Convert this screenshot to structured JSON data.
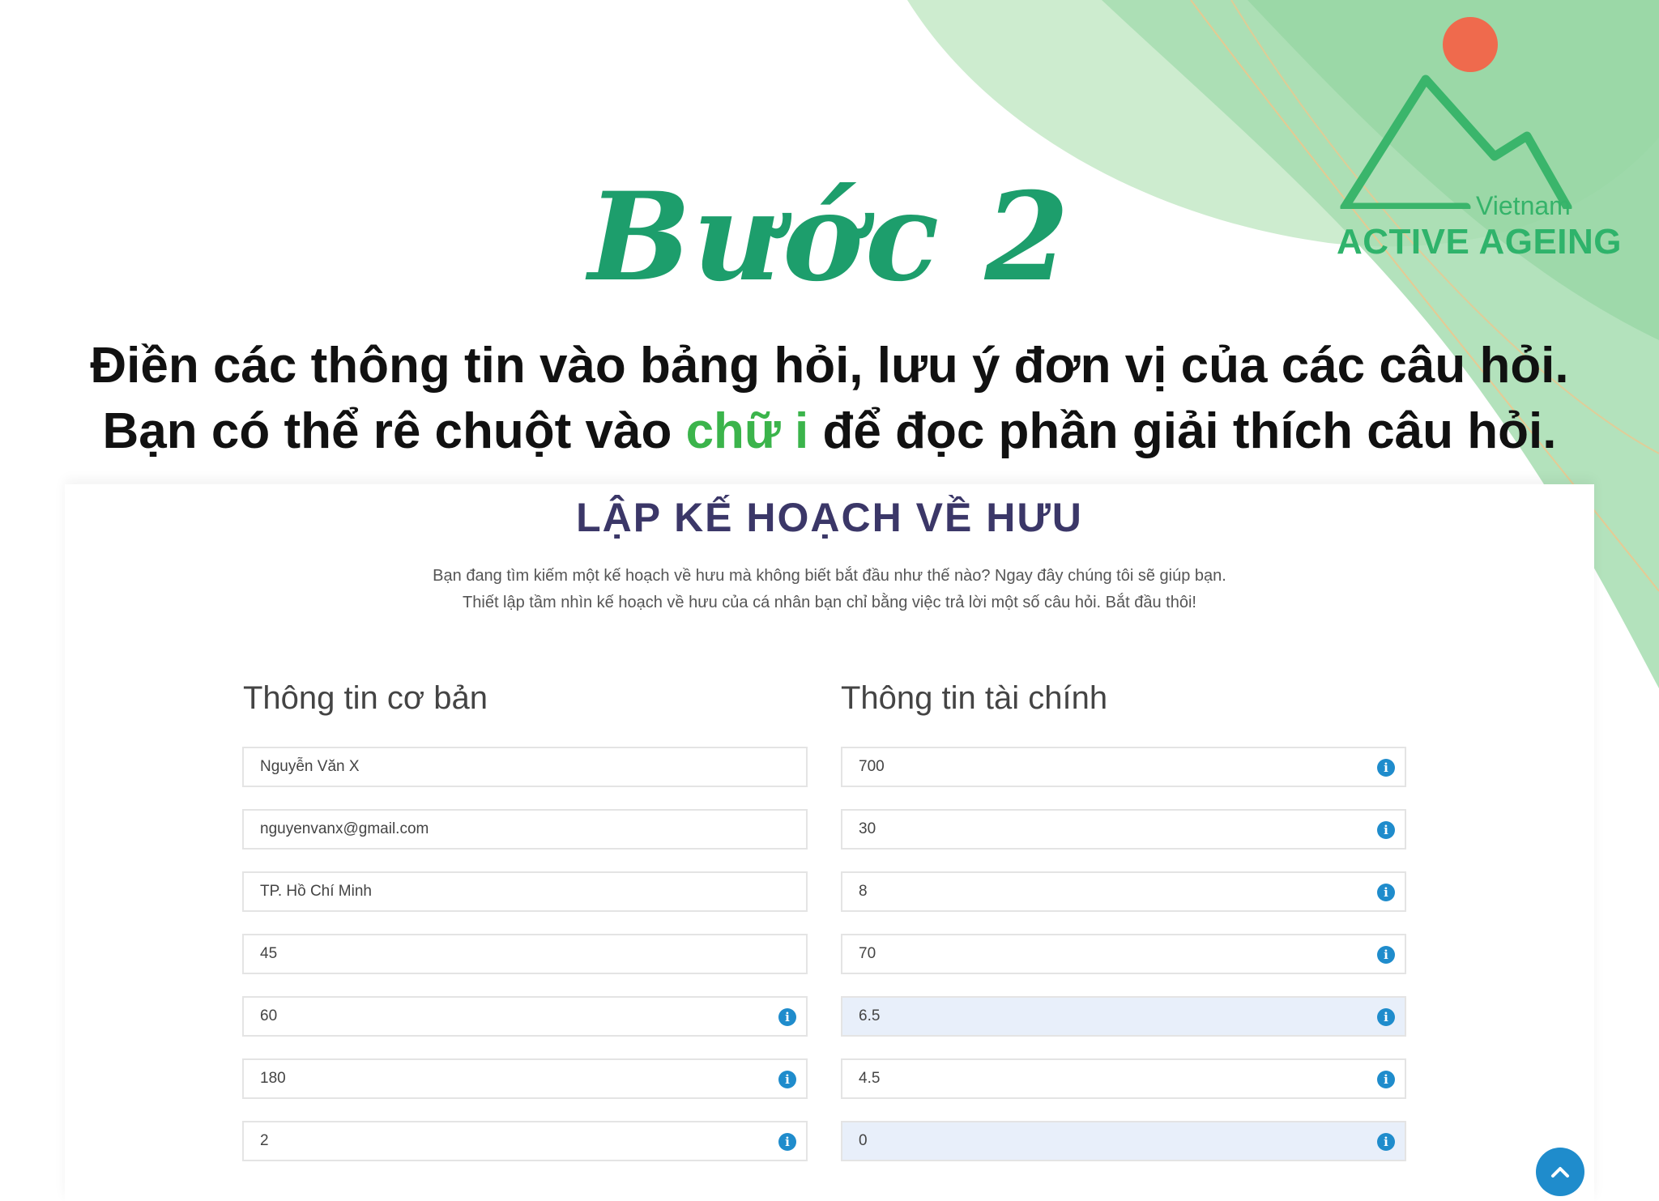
{
  "logo": {
    "vietnam": "Vietnam",
    "active_ageing": "ACTIVE AGEING",
    "sun_color": "#ef6a4d",
    "mountain_color": "#3ab56b"
  },
  "step": {
    "title": "Bước 2"
  },
  "instructions": {
    "line1": "Điền các thông tin vào bảng hỏi, lưu ý đơn vị của các câu hỏi.",
    "line2_before": "Bạn có thể rê chuột vào ",
    "line2_highlight": "chữ i",
    "line2_after": " để đọc phần giải thích câu hỏi."
  },
  "form": {
    "title": "LẬP KẾ HOẠCH VỀ HƯU",
    "intro_line1": "Bạn đang tìm kiếm một kế hoạch về hưu mà không biết bắt đầu như thế nào? Ngay đây chúng tôi sẽ giúp bạn.",
    "intro_line2": "Thiết lập tầm nhìn kế hoạch về hưu của cá nhân bạn chỉ bằng việc trả lời một số câu hỏi. Bắt đầu thôi!",
    "left_title": "Thông tin cơ bản",
    "right_title": "Thông tin tài chính",
    "left_fields": [
      {
        "value": "Nguyễn Văn X"
      },
      {
        "value": "nguyenvanx@gmail.com"
      },
      {
        "value": "TP. Hồ Chí Minh"
      },
      {
        "value": "45"
      },
      {
        "value": "60",
        "info": "i"
      },
      {
        "value": "180",
        "info": "i"
      },
      {
        "value": "2",
        "info": "i"
      }
    ],
    "right_fields": [
      {
        "value": "700",
        "info": "i"
      },
      {
        "value": "30",
        "info": "i"
      },
      {
        "value": "8",
        "info": "i"
      },
      {
        "value": "70",
        "info": "i"
      },
      {
        "value": "6.5",
        "info": "i"
      },
      {
        "value": "4.5",
        "info": "i"
      },
      {
        "value": "0",
        "info": "i"
      }
    ]
  },
  "colors": {
    "accent_green": "#1d9e6c",
    "highlight_green": "#3bb44b",
    "title_navy": "#3b3768",
    "info_blue": "#1f8ccc",
    "active_field_bg": "#e8effa"
  },
  "icons": {
    "info": "info-icon",
    "scroll_top": "chevron-up-icon"
  }
}
